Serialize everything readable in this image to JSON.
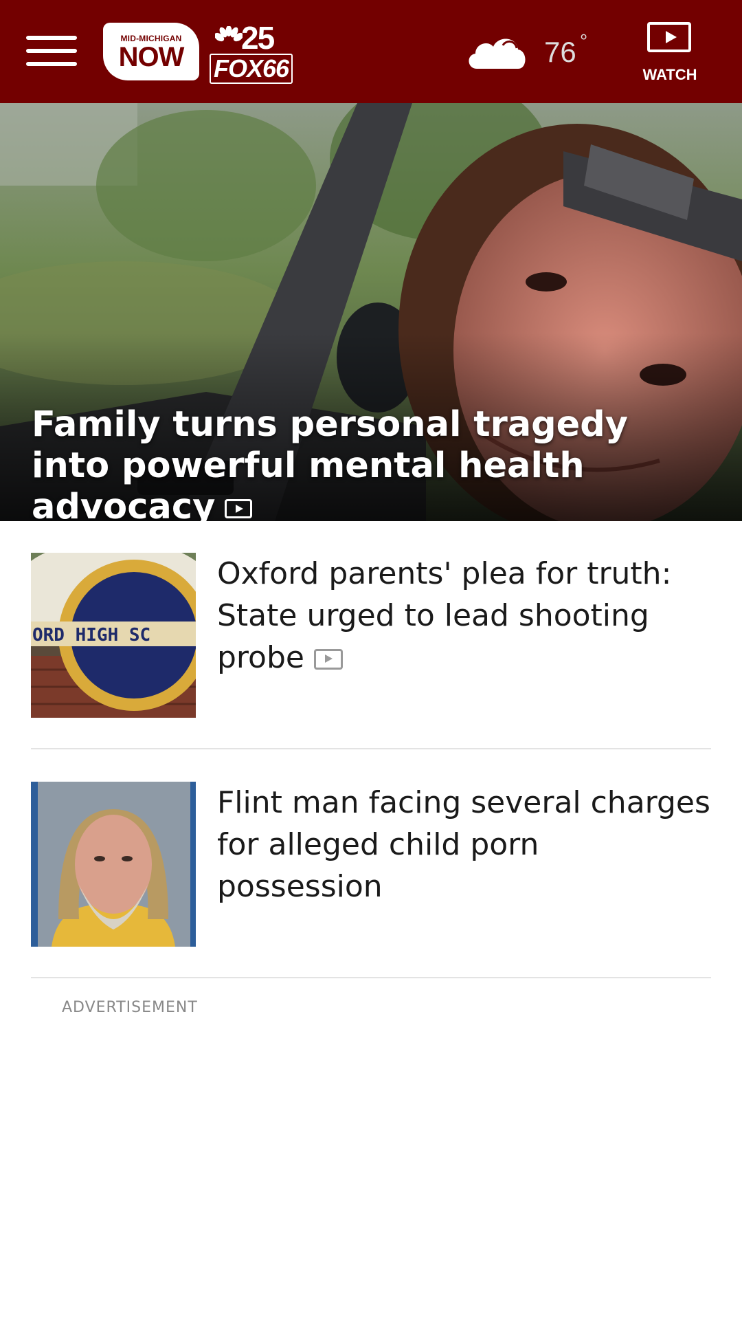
{
  "header": {
    "menu_icon": "hamburger-menu-icon",
    "logo_small": "MID-MICHIGAN",
    "logo_big": "NOW",
    "logo_channel": "25",
    "logo_fox": "FOX66",
    "weather": {
      "icon": "cloud-icon",
      "temperature": "76",
      "degree": "°"
    },
    "watch_label": "WATCH",
    "background_color": "#730000"
  },
  "hero": {
    "title": "Family turns personal tragedy into powerful mental health advocacy",
    "has_video": true
  },
  "stories": [
    {
      "title": "Oxford parents' plea for truth: State urged to lead shooting probe",
      "has_video": true,
      "thumb_text": "ORD HIGH SC"
    },
    {
      "title": "Flint man facing several charges for alleged child porn possession",
      "has_video": false
    }
  ],
  "advertisement_label": "ADVERTISEMENT"
}
